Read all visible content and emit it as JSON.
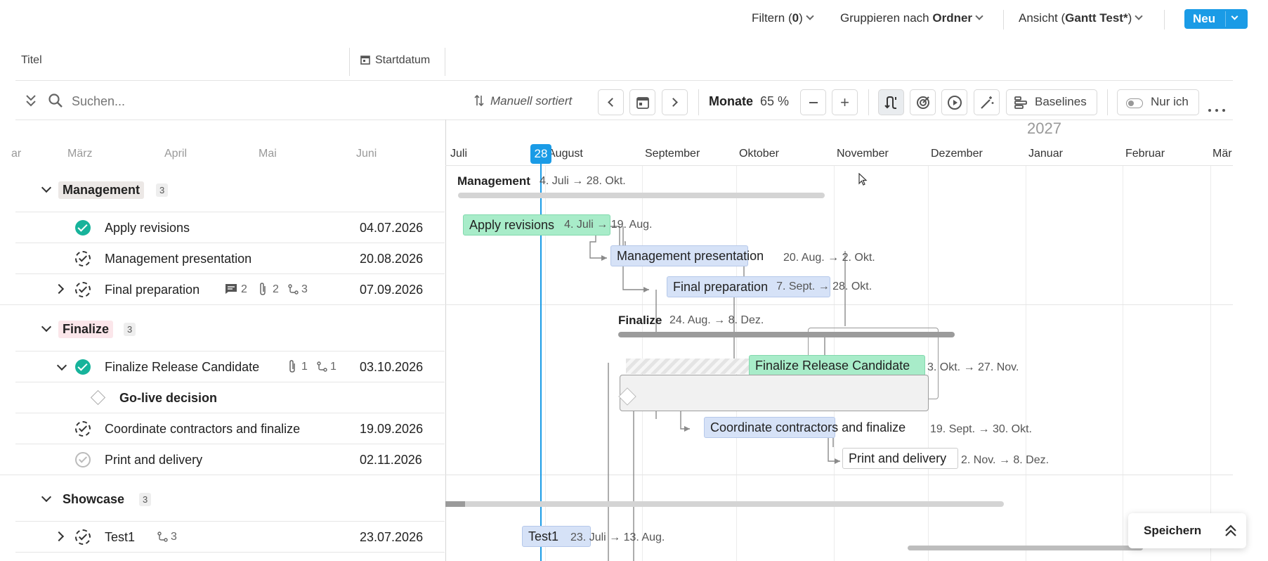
{
  "topbar": {
    "filter_label": "Filtern (",
    "filter_count": "0",
    "filter_close": ")",
    "group_label": "Gruppieren nach",
    "group_value": "Ordner",
    "view_label": "Ansicht (",
    "view_value": "Gantt Test*",
    "view_close": ")",
    "new_button": "Neu"
  },
  "columns": {
    "title": "Titel",
    "start": "Startdatum"
  },
  "toolbar": {
    "search_placeholder": "Suchen...",
    "sort_label": "Manuell sortiert",
    "zoom_unit": "Monate",
    "zoom_value": "65 %",
    "baselines": "Baselines",
    "only_me": "Nur ich"
  },
  "timeline": {
    "year": "2027",
    "today_marker": "28",
    "months_left": [
      "ar",
      "März",
      "April",
      "Mai",
      "Juni"
    ],
    "months_right": [
      "Juli",
      "August",
      "September",
      "Oktober",
      "November",
      "Dezember",
      "Januar",
      "Februar",
      "Mär"
    ]
  },
  "groups": [
    {
      "name": "Management",
      "count": "3",
      "color": "#ece8e6",
      "gantt_title": "Management",
      "gantt_dates": "4. Juli → 28. Okt."
    },
    {
      "name": "Finalize",
      "count": "3",
      "color": "#fbe6ea",
      "gantt_title": "Finalize",
      "gantt_dates": "24. Aug. → 8. Dez."
    },
    {
      "name": "Showcase",
      "count": "3",
      "color": "#ffffff"
    }
  ],
  "tasks": [
    {
      "title": "Apply revisions",
      "date": "04.07.2026",
      "bar_label": "Apply revisions",
      "bar_dates": "4. Juli → 19. Aug."
    },
    {
      "title": "Management presentation",
      "date": "20.08.2026",
      "bar_label": "Management presentation",
      "bar_dates": "20. Aug. → 2. Okt."
    },
    {
      "title": "Final preparation",
      "date": "07.09.2026",
      "comments": "2",
      "attachments": "2",
      "subtasks": "3",
      "bar_label": "Final preparation",
      "bar_dates": "7. Sept. → 28. Okt."
    },
    {
      "title": "Finalize Release Candidate",
      "date": "03.10.2026",
      "attachments": "1",
      "subtasks": "1",
      "bar_label": "Finalize Release Candidate",
      "bar_dates": "3. Okt. → 27. Nov."
    },
    {
      "title": "Go-live decision",
      "date": ""
    },
    {
      "title": "Coordinate contractors and finalize",
      "date": "19.09.2026",
      "bar_label": "Coordinate contractors and finalize",
      "bar_dates": "19. Sept. → 30. Okt."
    },
    {
      "title": "Print and delivery",
      "date": "02.11.2026",
      "bar_label": "Print and delivery",
      "bar_dates": "2. Nov. → 8. Dez."
    },
    {
      "title": "Test1",
      "date": "23.07.2026",
      "subtasks": "3",
      "bar_label": "Test1",
      "bar_dates": "23. Juli → 13. Aug."
    }
  ],
  "footer": {
    "save_button": "Speichern"
  },
  "colors": {
    "accent": "#1a9be6",
    "done_green": "#17b39b"
  }
}
